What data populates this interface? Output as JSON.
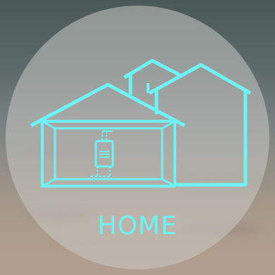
{
  "tile": {
    "label": "HOME",
    "icon": "house-icon",
    "accent_color": "#6ff2f4"
  }
}
